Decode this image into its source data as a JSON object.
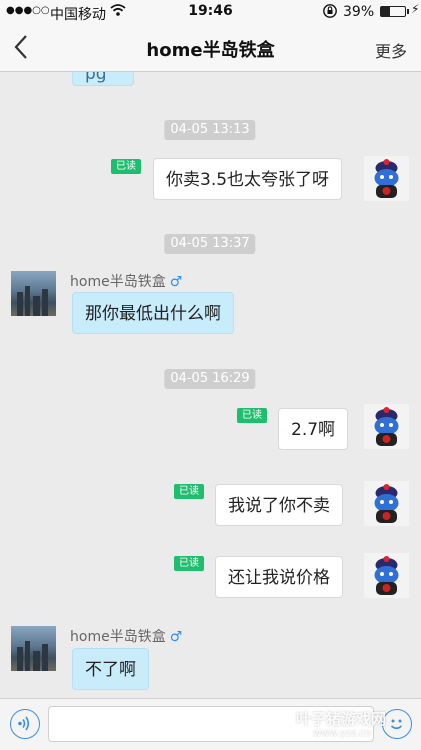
{
  "status_bar": {
    "signal_dots": "●●●○○",
    "carrier": "中国移动",
    "wifi_icon": "wifi-icon",
    "time": "19:46",
    "rotation_lock_icon": "rotation-lock-icon",
    "battery_percent": "39%",
    "battery_level": 0.39,
    "charging_icon": "charging-bolt-icon"
  },
  "nav": {
    "back_icon": "chevron-left-icon",
    "title": "home半岛铁盒",
    "more_label": "更多"
  },
  "chat": {
    "top_partial_text": "pg",
    "timestamps": [
      "04-05 13:13",
      "04-05 13:37",
      "04-05 16:29"
    ],
    "read_label": "已读",
    "sender_name": "home半岛铁盒",
    "gender_symbol": "♂",
    "messages": [
      {
        "from": "me",
        "text": "你卖3.5也太夸张了呀",
        "read": true
      },
      {
        "from": "them",
        "text": "那你最低出什么啊"
      },
      {
        "from": "me",
        "text": "2.7啊",
        "read": true
      },
      {
        "from": "me",
        "text": "我说了你不卖",
        "read": true
      },
      {
        "from": "me",
        "text": "还让我说价格",
        "read": true
      },
      {
        "from": "them",
        "text": "不了啊"
      }
    ]
  },
  "input_bar": {
    "voice_icon": "voice-icon",
    "input_value": "",
    "emoji_icon": "emoji-icon"
  },
  "watermark": {
    "text": "叶子猪游戏网",
    "url": "www.yzz.cn"
  },
  "colors": {
    "read_badge": "#1fbd6e",
    "their_bubble": "#c9ecfb",
    "gender_blue": "#2a8ff7"
  }
}
